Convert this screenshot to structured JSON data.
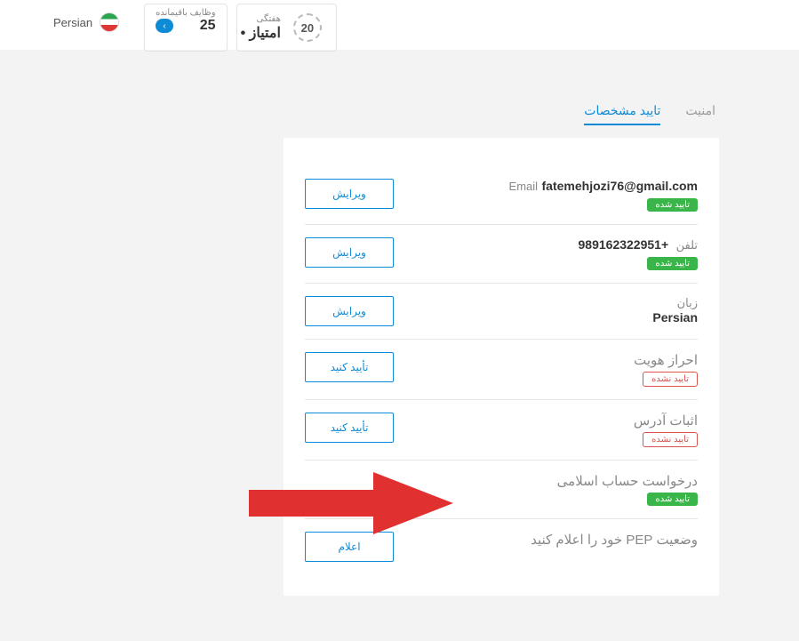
{
  "topbar": {
    "language": "Persian",
    "tasks_label": "وظایف باقیمانده",
    "tasks_value": "25",
    "points_label": "هفتگی",
    "points_value": "• امتیاز",
    "wreath_number": "20"
  },
  "tabs": {
    "security": "امنیت",
    "verification": "تایید مشخصات"
  },
  "rows": {
    "email": {
      "label": "Email",
      "value": "fatemehjozi76@gmail.com",
      "badge": "تایید شده",
      "button": "ویرایش"
    },
    "phone": {
      "label": "تلفن",
      "value": "+989162322951",
      "badge": "تایید شده",
      "button": "ویرایش"
    },
    "lang": {
      "label": "زبان",
      "value": "Persian",
      "button": "ویرایش"
    },
    "identity": {
      "label": "احراز هویت",
      "badge": "تایید نشده",
      "button": "تأیید کنید"
    },
    "address": {
      "label": "اثبات آدرس",
      "badge": "تایید نشده",
      "button": "تأیید کنید"
    },
    "islamic": {
      "label": "درخواست حساب اسلامی",
      "badge": "تایید شده"
    },
    "pep": {
      "label": "وضعیت PEP خود را اعلام کنید",
      "button": "اعلام"
    }
  }
}
